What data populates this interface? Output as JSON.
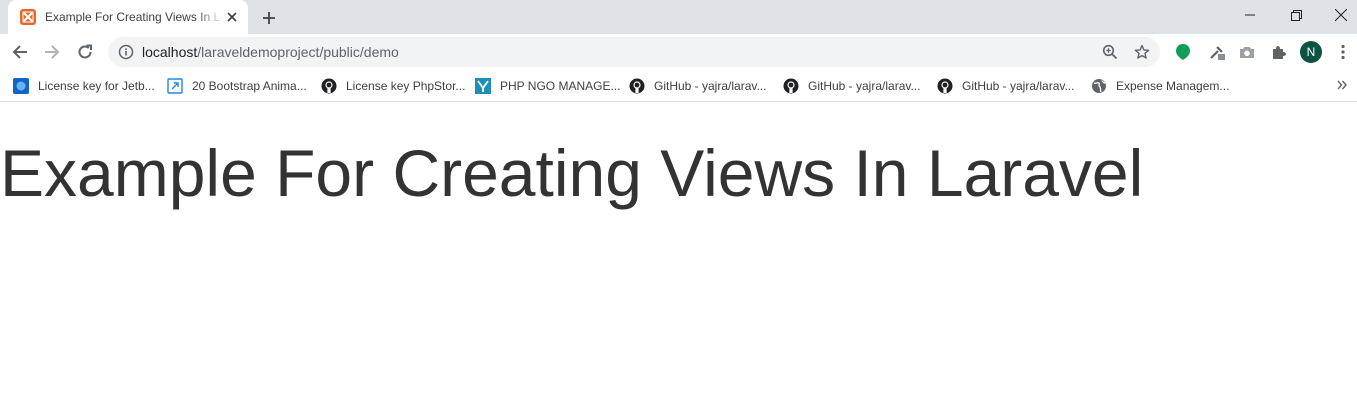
{
  "tab": {
    "title": "Example For Creating Views In Laravel"
  },
  "window": {
    "minimize": "—",
    "maximize": "❐",
    "close": "✕"
  },
  "toolbar": {
    "url_host": "localhost",
    "url_path": "/laraveldemoproject/public/demo",
    "avatar_letter": "N"
  },
  "bookmarks": [
    {
      "label": "License key for Jetb...",
      "icon": "jetbrains-icon"
    },
    {
      "label": "20 Bootstrap Anima...",
      "icon": "bootstrap-icon"
    },
    {
      "label": "License key PhpStor...",
      "icon": "github-icon"
    },
    {
      "label": "PHP NGO MANAGE...",
      "icon": "ngo-icon"
    },
    {
      "label": "GitHub - yajra/larav...",
      "icon": "github-icon"
    },
    {
      "label": "GitHub - yajra/larav...",
      "icon": "github-icon"
    },
    {
      "label": "GitHub - yajra/larav...",
      "icon": "github-icon"
    },
    {
      "label": "Expense Managem...",
      "icon": "globe-icon"
    }
  ],
  "page": {
    "heading": "Example For Creating Views In Laravel"
  },
  "colors": {
    "tabstrip": "#dee1e6",
    "omnibox": "#f1f3f4",
    "accent_green": "#0f9d58",
    "heading": "#333333"
  }
}
